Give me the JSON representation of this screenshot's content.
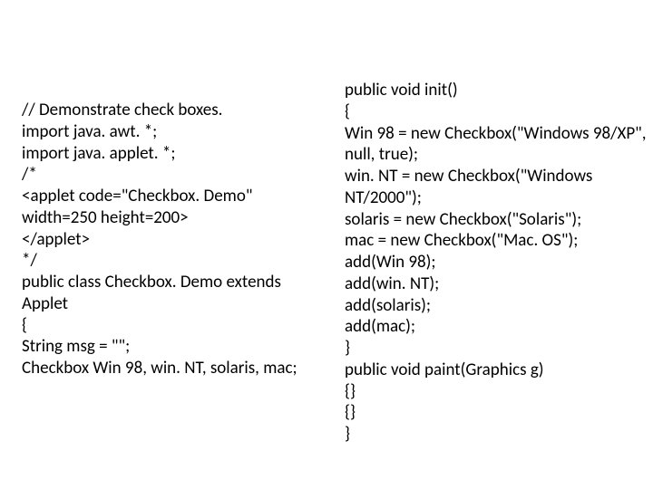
{
  "left": {
    "l0": "// Demonstrate check boxes.",
    "l1": "import java. awt. *;",
    "l2": "import java. applet. *;",
    "l3": "/*",
    "l4": "<applet code=\"Checkbox. Demo\"",
    "l5": "width=250 height=200>",
    "l6": "</applet>",
    "l7": "*/",
    "l8": "public class Checkbox. Demo extends",
    "l9": "Applet",
    "l10": "{",
    "l11": "String msg = \"\";",
    "l12": "Checkbox Win 98, win. NT, solaris, mac;"
  },
  "right": {
    "r0": "public void init()",
    "r1": "{",
    "r2": "Win 98 = new Checkbox(\"Windows 98/XP\",",
    "r3": "null, true);",
    "r4": "win. NT = new Checkbox(\"Windows",
    "r5": "NT/2000\");",
    "r6": "solaris = new Checkbox(\"Solaris\");",
    "r7": "mac = new Checkbox(\"Mac. OS\");",
    "r8": "add(Win 98);",
    "r9": "add(win. NT);",
    "r10": "add(solaris);",
    "r11": "add(mac);",
    "r12": "}",
    "r13": "public void paint(Graphics g)",
    "r14": "{}",
    "r15": "{}",
    "r16": "}"
  }
}
